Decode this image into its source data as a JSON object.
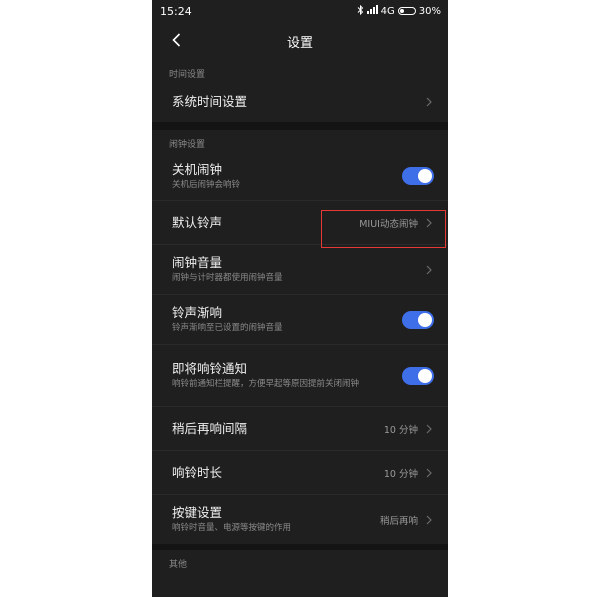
{
  "status": {
    "time": "15:24",
    "network": "4G",
    "battery": "30%",
    "battery_level": 0.3
  },
  "header": {
    "title": "设置"
  },
  "sections": [
    {
      "label": "时间设置",
      "items": [
        {
          "title": "系统时间设置"
        }
      ]
    },
    {
      "label": "闹钟设置",
      "items": [
        {
          "title": "关机闹钟",
          "subtitle": "关机后闹钟会响铃",
          "toggle_on": true
        },
        {
          "title": "默认铃声",
          "value": "MIUI动态闹钟"
        },
        {
          "title": "闹钟音量",
          "subtitle": "闹钟与计时器都使用闹钟音量"
        },
        {
          "title": "铃声渐响",
          "subtitle": "铃声渐响至已设置的闹钟音量",
          "toggle_on": true
        },
        {
          "title": "即将响铃通知",
          "subtitle": "响铃前通知栏提醒，方便早起等原因提前关闭闹钟",
          "toggle_on": true
        },
        {
          "title": "稍后再响间隔",
          "value": "10 分钟"
        },
        {
          "title": "响铃时长",
          "value": "10 分钟"
        },
        {
          "title": "按键设置",
          "subtitle": "响铃时音量、电源等按键的作用",
          "value": "稍后再响"
        }
      ]
    },
    {
      "label": "其他"
    }
  ],
  "colors": {
    "toggle_on": "#3f6fe8",
    "highlight": "#e53935",
    "background": "#1f1f1f"
  },
  "icons": [
    "back-arrow-icon",
    "bluetooth-icon",
    "signal-icon",
    "battery-icon",
    "chevron-right-icon"
  ]
}
